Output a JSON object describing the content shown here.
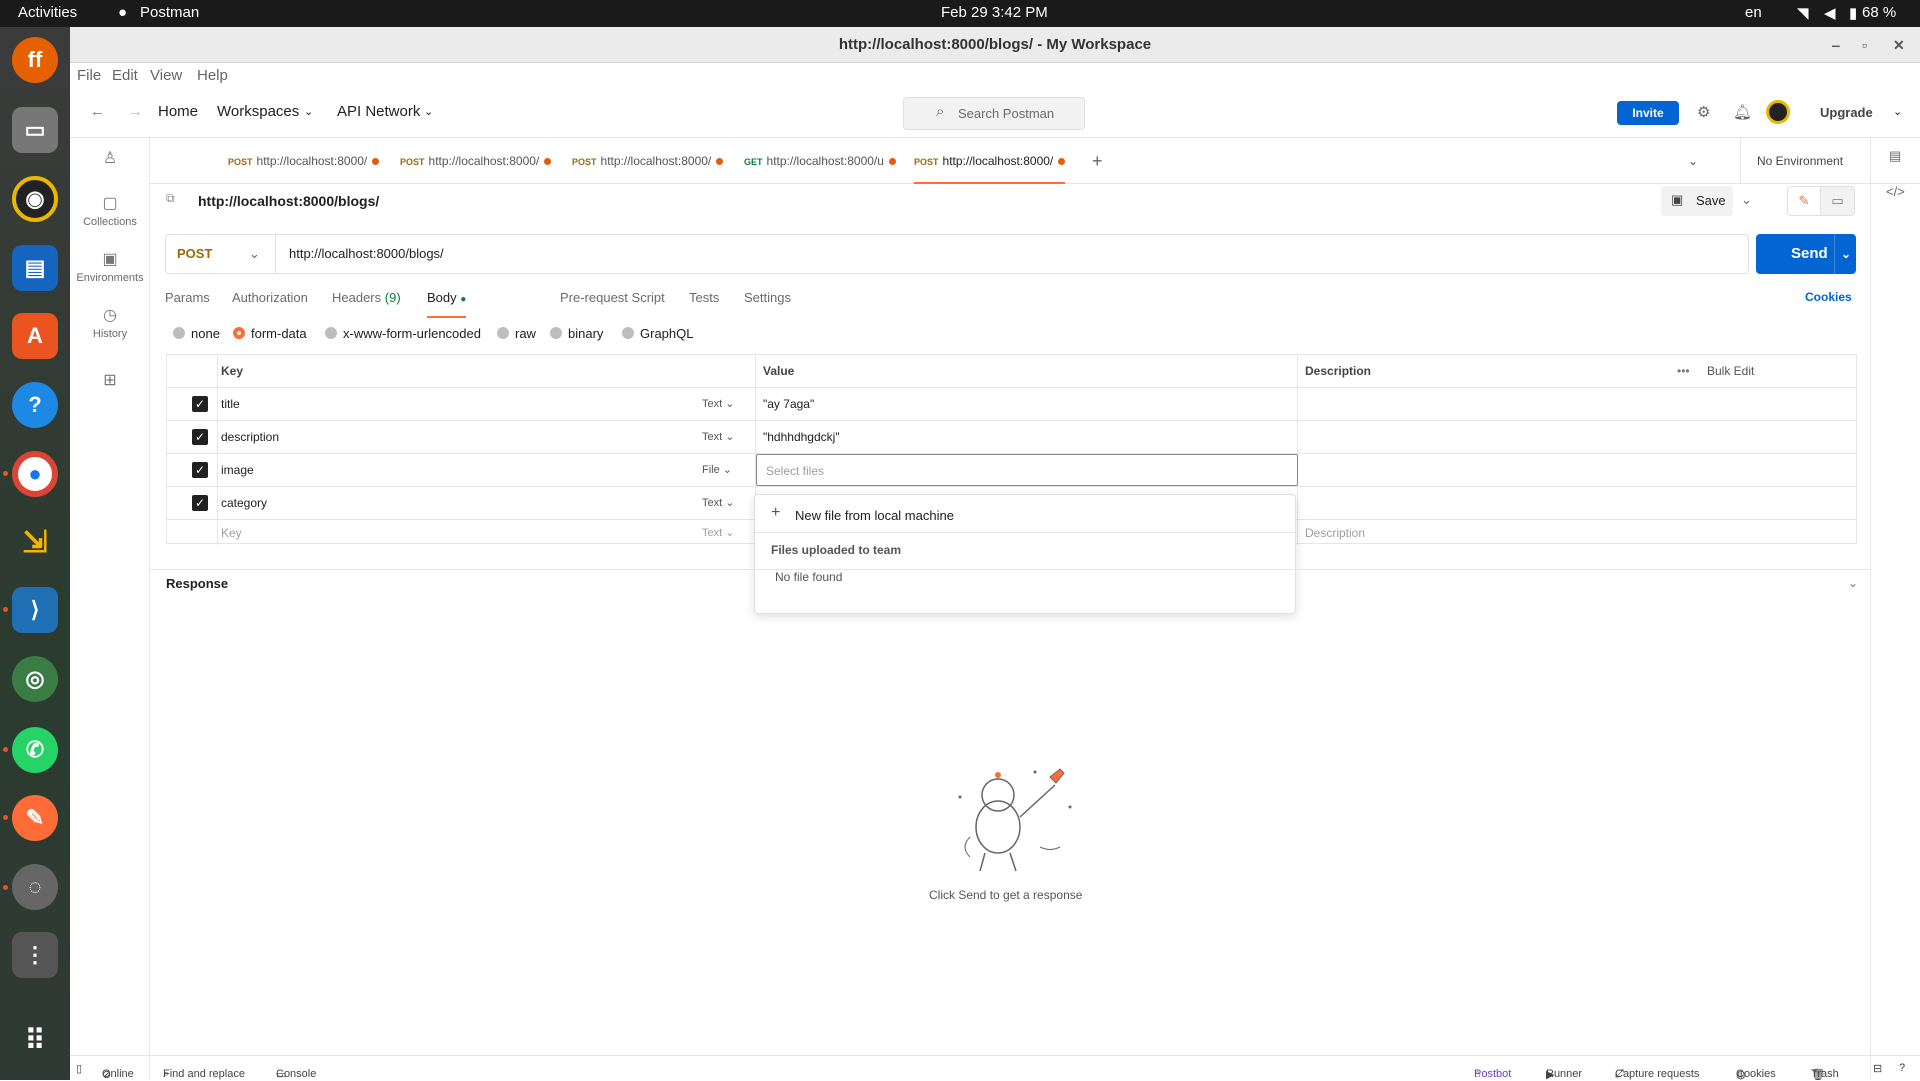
{
  "system": {
    "activities": "Activities",
    "app_name": "Postman",
    "clock": "Feb 29  3:42 PM",
    "lang": "en",
    "battery": "68 %"
  },
  "window": {
    "title": "http://localhost:8000/blogs/ - My Workspace"
  },
  "menu": [
    "File",
    "Edit",
    "View",
    "Help"
  ],
  "header": {
    "home": "Home",
    "workspaces": "Workspaces",
    "api_network": "API Network",
    "search_placeholder": "Search Postman",
    "invite": "Invite",
    "upgrade": "Upgrade"
  },
  "tabs": [
    {
      "method": "POST",
      "label": "http://localhost:8000/",
      "method_color": "#a0670a"
    },
    {
      "method": "POST",
      "label": "http://localhost:8000/",
      "method_color": "#a0670a"
    },
    {
      "method": "POST",
      "label": "http://localhost:8000/",
      "method_color": "#a0670a"
    },
    {
      "method": "GET",
      "label": "http://localhost:8000/u",
      "method_color": "#0f7b3c"
    },
    {
      "method": "POST",
      "label": "http://localhost:8000/",
      "method_color": "#a0670a"
    }
  ],
  "environment": "No Environment",
  "leftnav": {
    "collections": "Collections",
    "environments": "Environments",
    "history": "History"
  },
  "request": {
    "name": "http://localhost:8000/blogs/",
    "save": "Save",
    "method": "POST",
    "url": "http://localhost:8000/blogs/",
    "send": "Send"
  },
  "request_tabs": {
    "params": "Params",
    "authorization": "Authorization",
    "headers": "Headers",
    "headers_count": "(9)",
    "body": "Body",
    "prerequest": "Pre-request Script",
    "tests": "Tests",
    "settings": "Settings",
    "cookies": "Cookies"
  },
  "body_types": [
    "none",
    "form-data",
    "x-www-form-urlencoded",
    "raw",
    "binary",
    "GraphQL"
  ],
  "body_type_selected": "form-data",
  "grid": {
    "headers": {
      "key": "Key",
      "value": "Value",
      "description": "Description",
      "bulk_edit": "Bulk Edit"
    },
    "rows": [
      {
        "key": "title",
        "type": "Text",
        "value": "\"ay 7aga\""
      },
      {
        "key": "description",
        "type": "Text",
        "value": "\"hdhhdhgdckj\""
      },
      {
        "key": "image",
        "type": "File",
        "value": ""
      },
      {
        "key": "category",
        "type": "Text",
        "value": ""
      }
    ],
    "placeholder_row": {
      "key": "Key",
      "type": "Text",
      "description": "Description"
    },
    "select_files_placeholder": "Select files"
  },
  "file_popup": {
    "new_file": "New file from local machine",
    "team_heading": "Files uploaded to team",
    "empty": "No file found"
  },
  "response": {
    "label": "Response",
    "hint": "Click Send to get a response"
  },
  "statusbar": {
    "online": "Online",
    "find_replace": "Find and replace",
    "console": "Console",
    "postbot": "Postbot",
    "runner": "Runner",
    "capture": "Capture requests",
    "cookies": "Cookies",
    "trash": "Trash"
  }
}
